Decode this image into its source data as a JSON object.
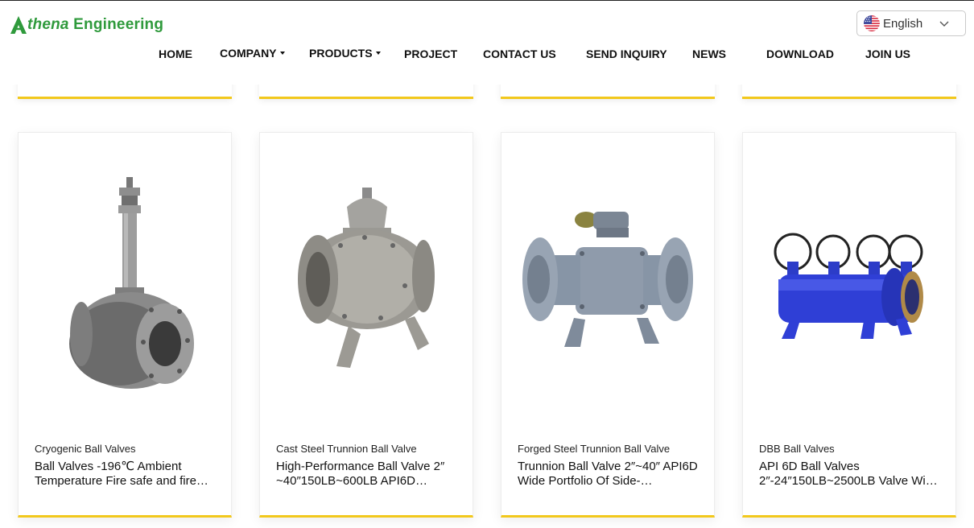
{
  "brand": {
    "logo_text": "Athena Engineering",
    "accent": "#2f9a3c"
  },
  "language": {
    "selected": "English"
  },
  "nav": [
    {
      "label": "HOME",
      "dropdown": false
    },
    {
      "label": "COMPANY",
      "dropdown": true
    },
    {
      "label": "PRODUCTS",
      "dropdown": true
    },
    {
      "label": "PROJECT",
      "dropdown": false
    },
    {
      "label": "CONTACT US",
      "dropdown": false
    },
    {
      "label": "SEND INQUIRY",
      "dropdown": false
    },
    {
      "label": "NEWS",
      "dropdown": false
    },
    {
      "label": "DOWNLOAD",
      "dropdown": false
    },
    {
      "label": "JOIN US",
      "dropdown": false
    }
  ],
  "products": [
    {
      "category": "Cryogenic Ball Valves",
      "title": "Ball Valves -196℃ Ambient Temperature Fire safe and fire…",
      "image_icon": "cryogenic-ball-valve-image"
    },
    {
      "category": "Cast Steel Trunnion Ball Valve",
      "title": "High-Performance Ball Valve 2″ ~40″150LB~600LB API6D…",
      "image_icon": "cast-steel-trunnion-valve-image"
    },
    {
      "category": "Forged Steel Trunnion Ball Valve",
      "title": "Trunnion Ball Valve 2″~40″ API6D Wide Portfolio Of Side-…",
      "image_icon": "forged-trunnion-valve-image"
    },
    {
      "category": "DBB Ball Valves",
      "title": "API 6D Ball Valves 2″-24″150LB~2500LB Valve Wi…",
      "image_icon": "dbb-ball-valve-image"
    }
  ],
  "colors": {
    "card_underline": "#f2c81c",
    "dbb_blue": "#2f3fd6",
    "steel": "#8a8c8e",
    "grey_paint": "#8f9bab"
  }
}
